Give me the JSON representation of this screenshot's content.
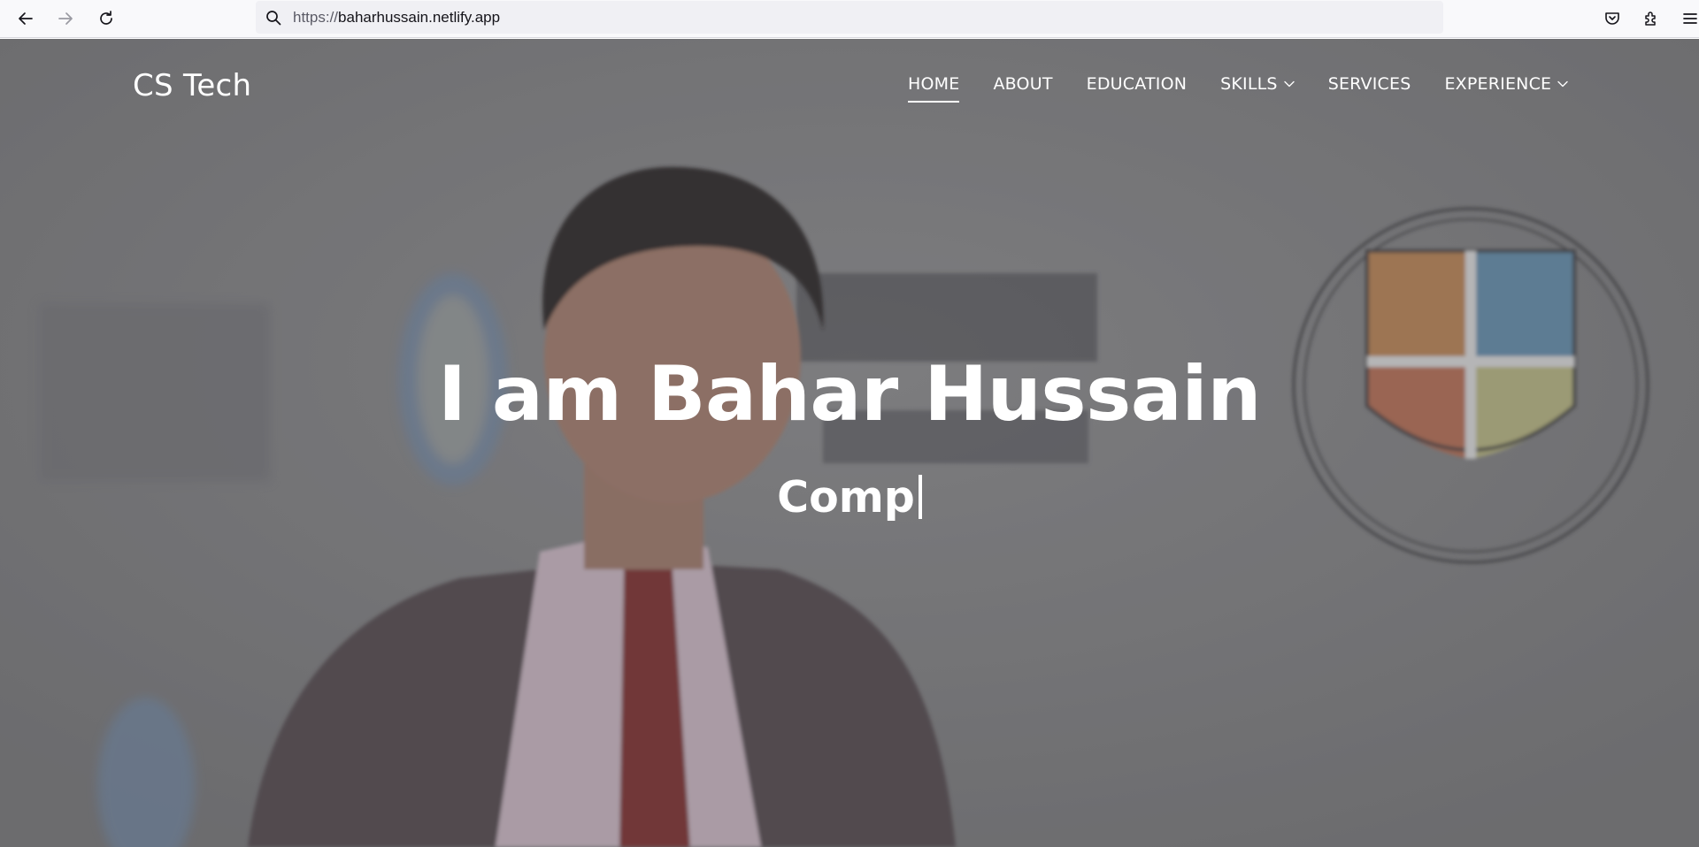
{
  "browser": {
    "url_protocol": "https://",
    "url_host": "baharhussain.netlify.app",
    "icons": [
      "back-arrow-icon",
      "forward-arrow-icon",
      "reload-icon",
      "search-icon",
      "pocket-icon",
      "extensions-icon",
      "menu-icon"
    ]
  },
  "site": {
    "brand": "CS Tech",
    "nav": [
      {
        "label": "HOME",
        "active": true
      },
      {
        "label": "ABOUT"
      },
      {
        "label": "EDUCATION"
      },
      {
        "label": "SKILLS",
        "dropdown": true
      },
      {
        "label": "SERVICES"
      },
      {
        "label": "EXPERIENCE",
        "dropdown": true
      }
    ]
  },
  "hero": {
    "title": "I am Bahar Hussain",
    "typed_text": "Comp"
  },
  "colors": {
    "overlay": "#7d7d7f",
    "text": "#ffffff"
  }
}
